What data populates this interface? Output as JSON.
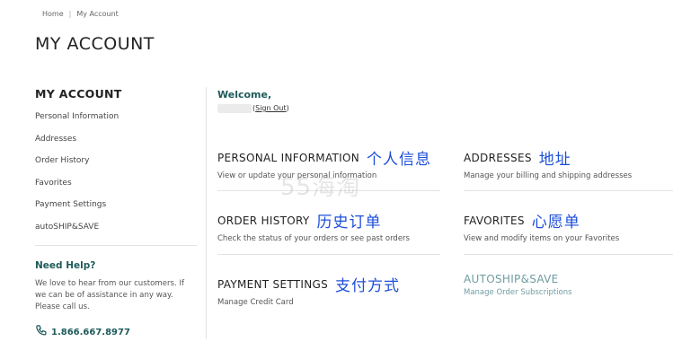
{
  "breadcrumb": {
    "home": "Home",
    "separator": "|",
    "current": "My Account"
  },
  "page_title": "MY ACCOUNT",
  "sidebar": {
    "title": "MY ACCOUNT",
    "items": [
      {
        "label": "Personal Information"
      },
      {
        "label": "Addresses"
      },
      {
        "label": "Order History"
      },
      {
        "label": "Favorites"
      },
      {
        "label": "Payment Settings"
      },
      {
        "label": "autoSHIP&SAVE"
      }
    ]
  },
  "help": {
    "title": "Need Help?",
    "text": "We love to hear from our customers. If\nwe can be of assistance in any way.\nPlease call us.",
    "phone": "1.866.667.8977",
    "phone_icon": "phone-icon"
  },
  "welcome": {
    "label": "Welcome,",
    "signout": "Sign Out"
  },
  "cards": {
    "personal": {
      "title": "PERSONAL INFORMATION",
      "cn": "个人信息",
      "desc": "View or update your personal information"
    },
    "addresses": {
      "title": "ADDRESSES",
      "cn": "地址",
      "desc": "Manage your billing and shipping addresses"
    },
    "orders": {
      "title": "ORDER HISTORY",
      "cn": "历史订单",
      "desc": "Check the status of your orders or see past orders"
    },
    "favorites": {
      "title": "FAVORITES",
      "cn": "心愿单",
      "desc": "View and modify items on your Favorites"
    },
    "payment": {
      "title": "PAYMENT SETTINGS",
      "cn": "支付方式",
      "desc": "Manage Credit Card"
    },
    "autoship": {
      "title": "AUTOSHIP&SAVE",
      "desc": "Manage Order Subscriptions"
    }
  },
  "watermark": "55海淘",
  "colors": {
    "accent": "#1f5a5a",
    "annotation": "#1d4fd8",
    "muted_link": "#6f9ca3"
  }
}
